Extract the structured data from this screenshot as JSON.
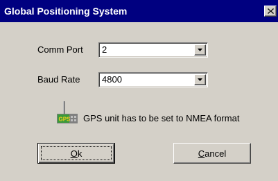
{
  "window": {
    "title": "Global Positioning System",
    "close_icon": "close-x-icon"
  },
  "comm_port": {
    "label": "Comm Port",
    "value": "2"
  },
  "baud_rate": {
    "label": "Baud Rate",
    "value": "4800"
  },
  "note": {
    "icon": "gps-unit-icon",
    "icon_text": "GPS",
    "text": "GPS unit has to be set to NMEA format"
  },
  "buttons": {
    "ok": {
      "mnemonic": "O",
      "rest": "k"
    },
    "cancel": {
      "mnemonic": "C",
      "rest": "ancel"
    }
  },
  "colors": {
    "title_bar": "#000080",
    "face": "#d4d0c8",
    "gps_icon_green": "#3a9a3a"
  }
}
